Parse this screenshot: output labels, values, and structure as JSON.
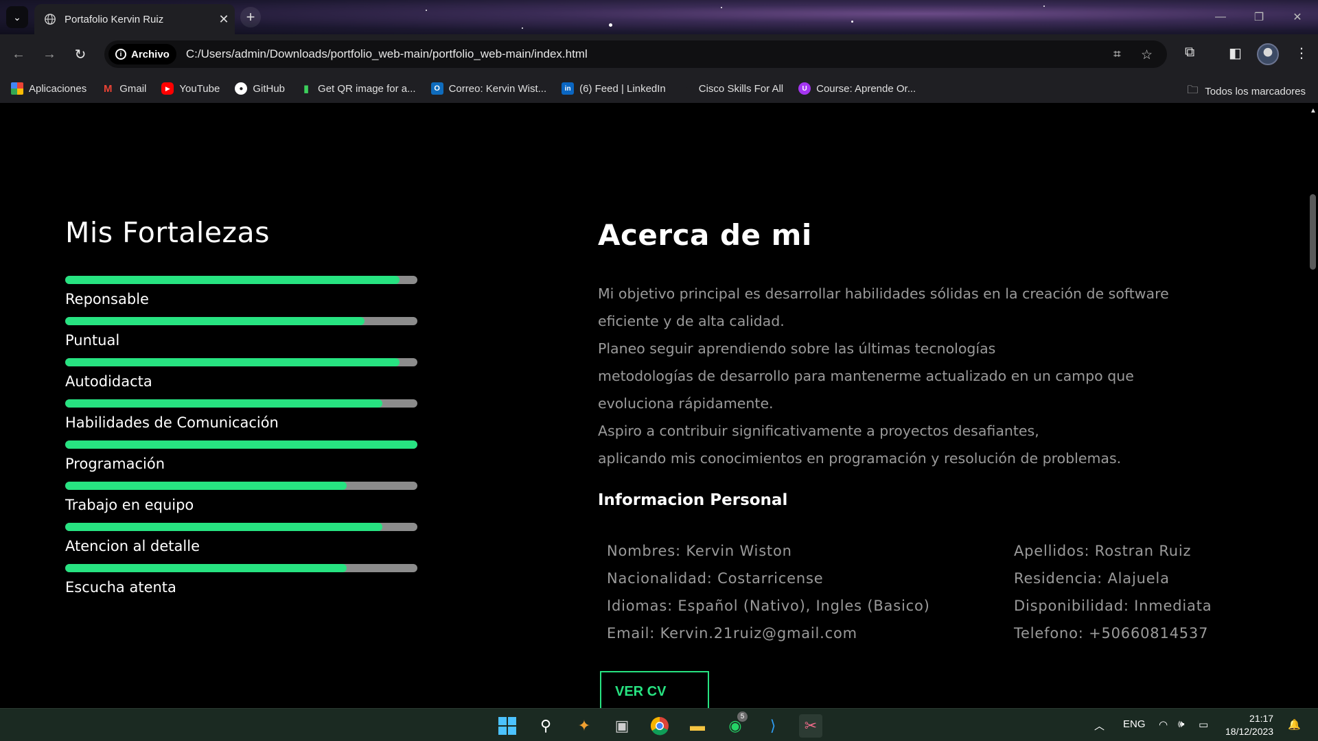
{
  "browser": {
    "tab_title": "Portafolio Kervin Ruiz",
    "tab_close": "✕",
    "new_tab": "+",
    "chip_label": "Archivo",
    "url": "C:/Users/admin/Downloads/portfolio_web-main/portfolio_web-main/index.html",
    "bookmarks": [
      {
        "label": "Aplicaciones",
        "icon": "apps-grid-icon"
      },
      {
        "label": "Gmail",
        "icon": "gmail-icon"
      },
      {
        "label": "YouTube",
        "icon": "youtube-icon"
      },
      {
        "label": "GitHub",
        "icon": "github-icon"
      },
      {
        "label": "Get QR image for a...",
        "icon": "qr-chart-icon"
      },
      {
        "label": "Correo: Kervin Wist...",
        "icon": "outlook-icon"
      },
      {
        "label": "(6) Feed | LinkedIn",
        "icon": "linkedin-icon"
      },
      {
        "label": "Cisco Skills For All",
        "icon": "cisco-icon"
      },
      {
        "label": "Course: Aprende Or...",
        "icon": "course-icon"
      }
    ],
    "all_bookmarks": "Todos los marcadores"
  },
  "strengths": {
    "title": "Mis Fortalezas",
    "accent": "#27e381",
    "track_color": "#8c8c8c",
    "items": [
      {
        "label": "Reponsable",
        "level": 0.95
      },
      {
        "label": "Puntual",
        "level": 0.85
      },
      {
        "label": "Autodidacta",
        "level": 0.95
      },
      {
        "label": "Habilidades de Comunicación",
        "level": 0.9
      },
      {
        "label": "Programación",
        "level": 1.0
      },
      {
        "label": "Trabajo en equipo",
        "level": 0.8
      },
      {
        "label": "Atencion al detalle",
        "level": 0.9
      },
      {
        "label": "Escucha atenta",
        "level": 0.8
      }
    ]
  },
  "about": {
    "title": "Acerca de mi",
    "lines": [
      "Mi objetivo principal es desarrollar habilidades sólidas en la creación de software",
      "eficiente y de alta calidad.",
      "Planeo seguir aprendiendo sobre las últimas tecnologías",
      "metodologías de desarrollo para mantenerme actualizado en un campo que",
      "evoluciona rápidamente.",
      "Aspiro a contribuir significativamente a proyectos desafiantes,",
      "aplicando mis conocimientos en programación y resolución de problemas."
    ],
    "info_title": "Informacion Personal",
    "info_left": [
      "Nombres: Kervin Wiston",
      "Nacionalidad: Costarricense",
      "Idiomas: Español (Nativo), Ingles (Basico)",
      "Email: Kervin.21ruiz@gmail.com"
    ],
    "info_right": [
      "Apellidos: Rostran Ruiz",
      "Residencia: Alajuela",
      "Disponibilidad: Inmediata",
      "Telefono: +50660814537"
    ],
    "cv_button": "VER CV"
  },
  "taskbar": {
    "language": "ENG",
    "time": "21:17",
    "date": "18/12/2023",
    "whatsapp_badge": "5"
  }
}
